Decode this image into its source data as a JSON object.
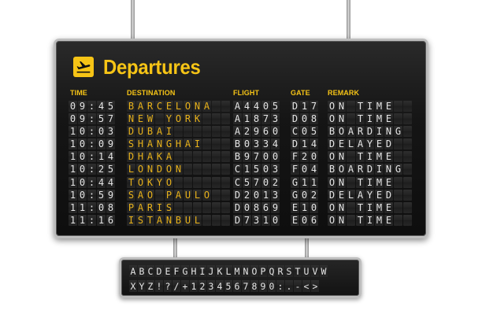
{
  "board": {
    "title": "Departures",
    "headers": {
      "time": "TIME",
      "destination": "DESTINATION",
      "flight": "FLIGHT",
      "gate": "GATE",
      "remark": "REMARK"
    },
    "accent_color": "#f6c416",
    "destination_color": "#e8b21b",
    "flights": [
      {
        "time": "09:45",
        "destination": "BARCELONA",
        "flight": "A4405",
        "gate": "D17",
        "remark": "ON TIME"
      },
      {
        "time": "09:57",
        "destination": "NEW YORK",
        "flight": "A1873",
        "gate": "D08",
        "remark": "ON TIME"
      },
      {
        "time": "10:03",
        "destination": "DUBAI",
        "flight": "A2960",
        "gate": "C05",
        "remark": "BOARDING"
      },
      {
        "time": "10:09",
        "destination": "SHANGHAI",
        "flight": "B0334",
        "gate": "D14",
        "remark": "DELAYED"
      },
      {
        "time": "10:14",
        "destination": "DHAKA",
        "flight": "B9700",
        "gate": "F20",
        "remark": "ON TIME"
      },
      {
        "time": "10:25",
        "destination": "LONDON",
        "flight": "C1503",
        "gate": "F04",
        "remark": "BOARDING"
      },
      {
        "time": "10:44",
        "destination": "TOKYO",
        "flight": "C5702",
        "gate": "G11",
        "remark": "ON TIME"
      },
      {
        "time": "10:59",
        "destination": "SAO PAULO",
        "flight": "D2013",
        "gate": "G02",
        "remark": "DELAYED"
      },
      {
        "time": "11:08",
        "destination": "PARIS",
        "flight": "D0869",
        "gate": "E10",
        "remark": "ON TIME"
      },
      {
        "time": "11:16",
        "destination": "ISTANBUL",
        "flight": "D7310",
        "gate": "E06",
        "remark": "ON TIME"
      }
    ]
  },
  "alphabet": {
    "row1": "ABCDEFGHIJKLMNOPQRSTUVW",
    "row2": "XYZ!?/+1234567890:.-<>"
  },
  "icons": {
    "plane": "airplane-departure-icon"
  }
}
